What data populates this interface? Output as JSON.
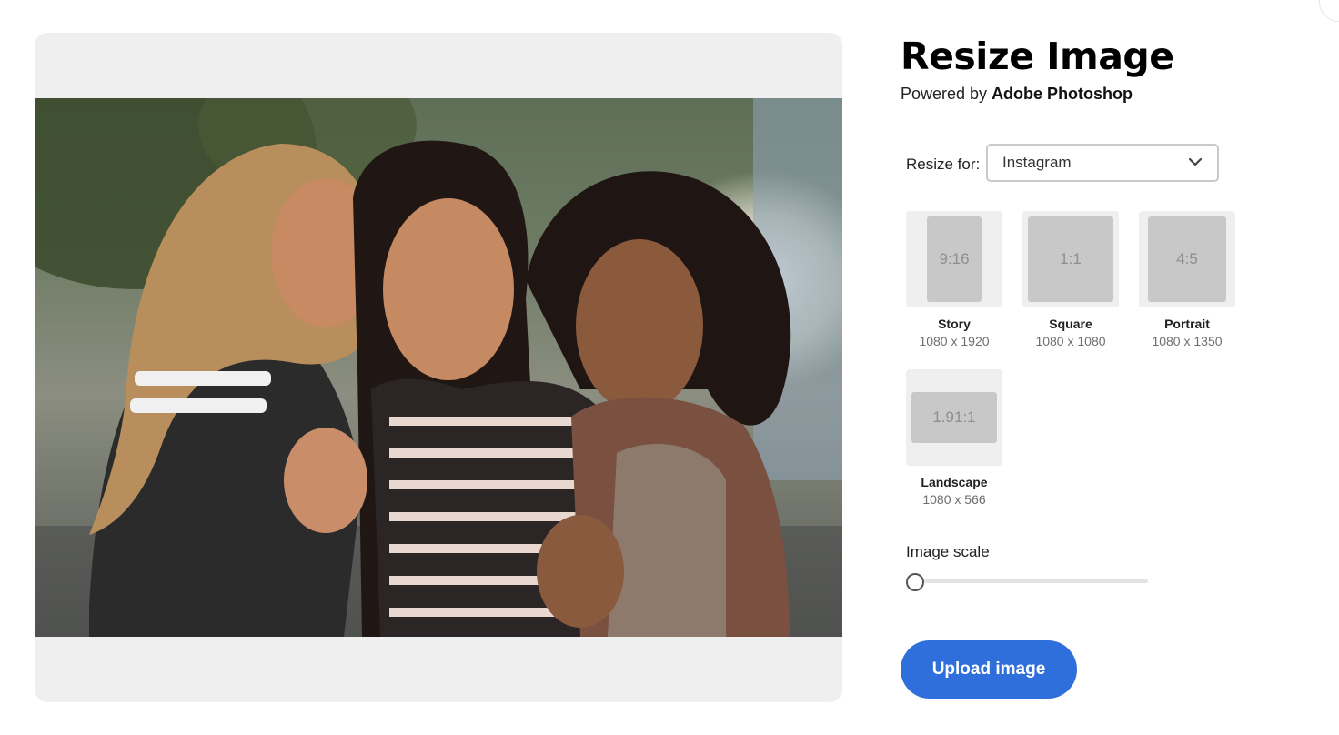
{
  "header": {
    "title": "Resize Image",
    "powered_prefix": "Powered by ",
    "powered_brand": "Adobe Photoshop"
  },
  "resize": {
    "label": "Resize for:",
    "selected": "Instagram"
  },
  "options": [
    {
      "ratio": "9:16",
      "name": "Story",
      "dims": "1080 x 1920"
    },
    {
      "ratio": "1:1",
      "name": "Square",
      "dims": "1080 x 1080"
    },
    {
      "ratio": "4:5",
      "name": "Portrait",
      "dims": "1080 x 1350"
    },
    {
      "ratio": "1.91:1",
      "name": "Landscape",
      "dims": "1080 x 566"
    }
  ],
  "scale": {
    "label": "Image scale",
    "value": 0
  },
  "upload": {
    "label": "Upload image"
  },
  "colors": {
    "accent": "#2f6fdb",
    "panel": "#efefef"
  }
}
